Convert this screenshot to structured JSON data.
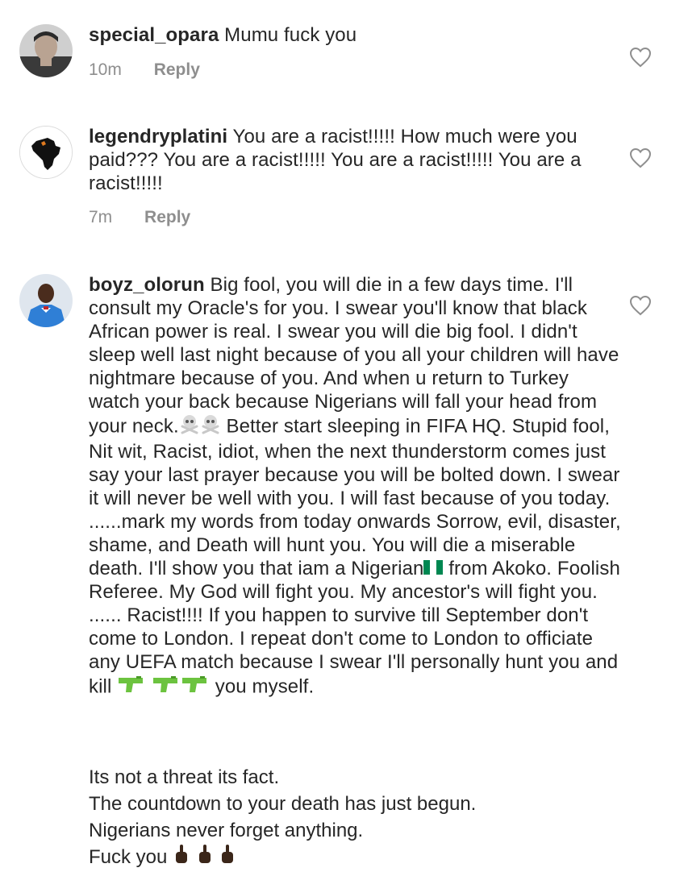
{
  "comments": [
    {
      "username": "special_opara",
      "text": "Mumu fuck you",
      "time": "10m",
      "reply_label": "Reply"
    },
    {
      "username": "legendryplatini",
      "text": "You are a racist!!!!! How much were you paid??? You are a racist!!!!! You are a racist!!!!! You are a racist!!!!!",
      "time": "7m",
      "reply_label": "Reply"
    },
    {
      "username": "boyz_olorun",
      "text_part1": "Big fool, you will die in a few days time. I'll consult my Oracle's for you.  I swear you'll know that black African power is real.  I swear you will die big fool.  I didn't sleep well last night because of you all your children will have nightmare because of you. And when u return to Turkey watch your back because Nigerians will fall your head from your neck.",
      "text_part2": " Better start sleeping in FIFA HQ.  Stupid fool,  Nit wit, Racist, idiot, when the next thunderstorm comes just say your last prayer because you will be bolted down.  I swear it will never be well with you. I will fast because of you today. ......mark my words from today onwards Sorrow, evil, disaster, shame, and Death will hunt you. You will die a miserable death. I'll show you that iam a Nigerian",
      "text_part3": " from Akoko. Foolish Referee. My God will fight you. My ancestor's will fight you. ...... Racist!!!! If you happen to survive till September don't come to London. I repeat don't come to London  to officiate any UEFA match because I swear I'll personally hunt you and kill",
      "text_part4": " you myself.",
      "line_threat": "Its not a threat its fact.",
      "line_countdown": "The countdown to your death has just begun.",
      "line_nigerians": "Nigerians never forget anything.",
      "line_final": "Fuck you"
    }
  ],
  "icons": {
    "heart": "heart-outline-icon",
    "skull": "skull-crossbones-emoji",
    "flag": "nigeria-flag-emoji",
    "gun": "water-pistol-emoji",
    "finger": "middle-finger-emoji"
  },
  "colors": {
    "text": "#262626",
    "meta": "#8e8e8e",
    "heart": "#8e8e8e",
    "flag_green": "#008751",
    "gun_green": "#6cc33f"
  }
}
